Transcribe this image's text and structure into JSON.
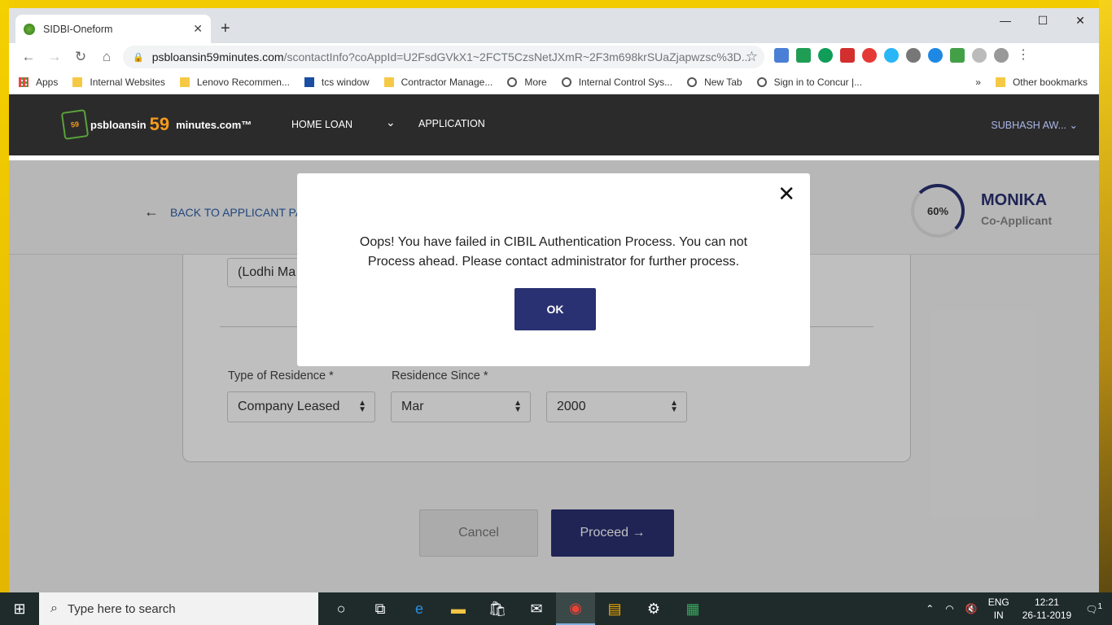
{
  "browser": {
    "tab_title": "SIDBI-Oneform",
    "url_host": "psbloansin59minutes.com",
    "url_path": "/scontactInfo?coAppId=U2FsdGVkX1~2FCT5CzsNetJXmR~2F3m698krSUaZjapwzsc%3D...",
    "bookmarks": [
      "Apps",
      "Internal Websites",
      "Lenovo Recommen...",
      "tcs window",
      "Contractor Manage...",
      "More",
      "Internal Control Sys...",
      "New Tab",
      "Sign in to Concur |..."
    ],
    "other_bookmarks": "Other bookmarks"
  },
  "site": {
    "logo_left": "psbloansin",
    "logo_59": "59",
    "logo_right": "minutes.com™",
    "logo_badge": "59",
    "nav_home": "HOME LOAN",
    "nav_app": "APPLICATION",
    "user": "SUBHASH AW..."
  },
  "subheader": {
    "back_label": "BACK TO APPLICANT PA",
    "progress": "60%",
    "name": "MONIKA",
    "role": "Co-Applicant"
  },
  "form": {
    "partial_value": "(Lodhi Ma",
    "residence_type_label": "Type of Residence *",
    "residence_type_value": "Company Leased",
    "residence_since_label": "Residence Since *",
    "month_value": "Mar",
    "year_value": "2000",
    "cancel": "Cancel",
    "proceed": "Proceed →"
  },
  "modal": {
    "message_line1": "Oops! You have failed in CIBIL Authentication Process. You can not",
    "message_line2": "Process ahead. Please contact administrator for further process.",
    "ok": "OK"
  },
  "taskbar": {
    "search_placeholder": "Type here to search",
    "lang_top": "ENG",
    "lang_bottom": "IN",
    "time": "12:21",
    "date": "26-11-2019",
    "notifications": "1"
  }
}
